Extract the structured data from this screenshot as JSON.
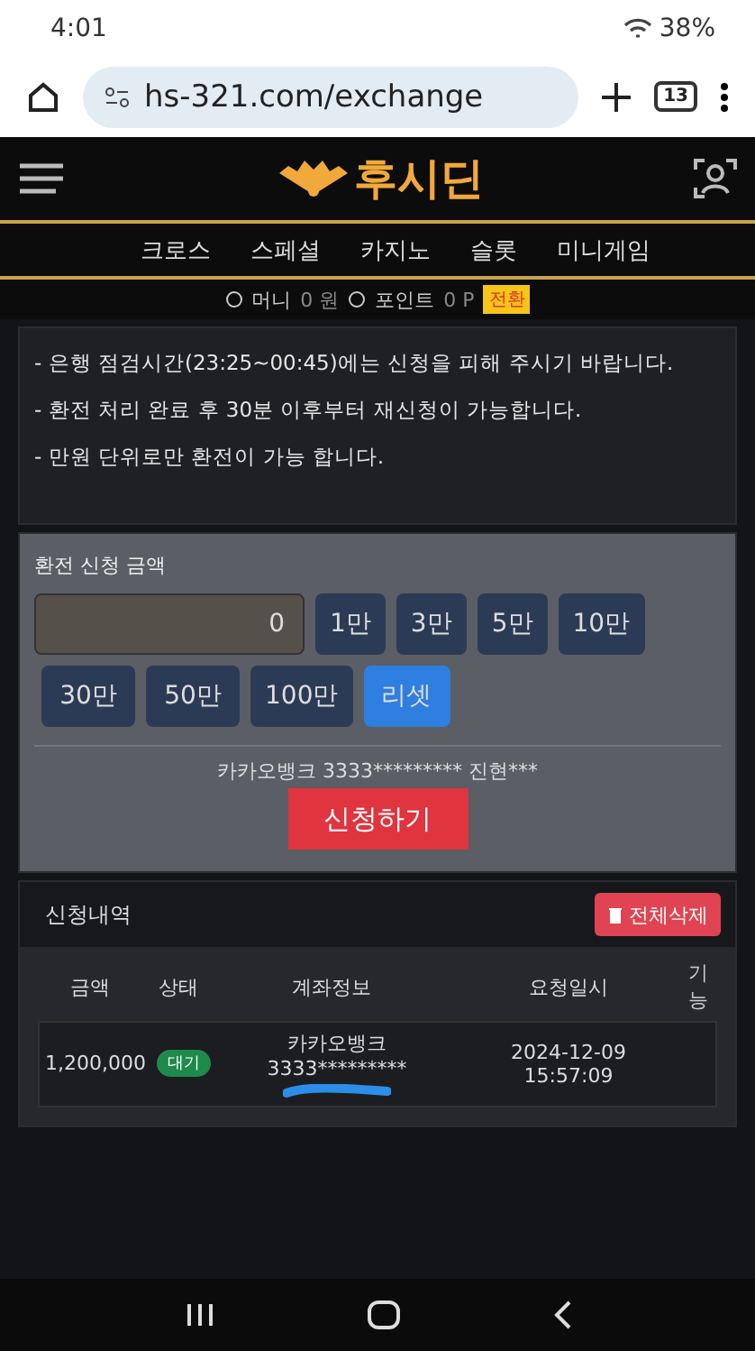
{
  "status_bar": {
    "time": "4:01",
    "battery": "38%"
  },
  "browser": {
    "url": "hs-321.com/exchange",
    "tab_count": "13"
  },
  "header": {
    "logo_text": "후시딘"
  },
  "nav": [
    "크로스",
    "스페셜",
    "카지노",
    "슬롯",
    "미니게임"
  ],
  "wallet": {
    "money_label": "머니",
    "money_value": "0 원",
    "point_label": "포인트",
    "point_value": "0 P",
    "convert_button": "전환"
  },
  "notices": [
    "- 은행 점검시간(23:25~00:45)에는 신청을 피해 주시기 바랍니다.",
    "- 환전 처리 완료 후 30분 이후부터 재신청이 가능합니다.",
    "- 만원 단위로만 환전이 가능 합니다."
  ],
  "form": {
    "label": "환전 신청 금액",
    "amount": "0",
    "buttons": [
      {
        "label": "1만",
        "kind": "amount"
      },
      {
        "label": "3만",
        "kind": "amount"
      },
      {
        "label": "5만",
        "kind": "amount"
      },
      {
        "label": "10만",
        "kind": "amount"
      },
      {
        "label": "30만",
        "kind": "amount"
      },
      {
        "label": "50만",
        "kind": "amount"
      },
      {
        "label": "100만",
        "kind": "amount"
      },
      {
        "label": "리셋",
        "kind": "reset"
      }
    ],
    "account": "카카오뱅크 3333********* 진현***",
    "submit": "신청하기"
  },
  "history": {
    "title": "신청내역",
    "clear_button": "전체삭제",
    "columns": [
      "금액",
      "상태",
      "계좌정보",
      "요청일시",
      "기능"
    ],
    "rows": [
      {
        "amount": "1,200,000",
        "status": "대기",
        "account": "카카오뱅크 3333*********",
        "date": "2024-12-09",
        "time": "15:57:09"
      }
    ]
  }
}
